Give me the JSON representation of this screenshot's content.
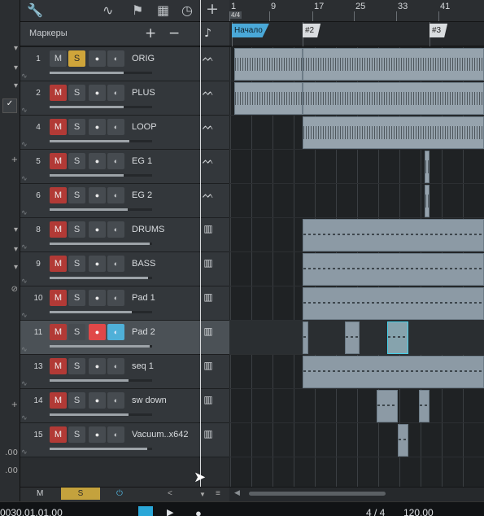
{
  "left_strip": {
    "items": [
      {
        "text": "▾",
        "kind": "arrow"
      },
      {
        "text": "▾",
        "kind": "arrow"
      },
      {
        "text": "▾",
        "kind": "arrow"
      },
      {
        "text": "✓",
        "kind": "box"
      },
      {
        "text": "+",
        "kind": "plain"
      },
      {
        "text": "▾",
        "kind": "arrow"
      },
      {
        "text": "▾",
        "kind": "arrow"
      },
      {
        "text": "▾",
        "kind": "arrow"
      },
      {
        "text": "⊘",
        "kind": "plain"
      },
      {
        "text": "+",
        "kind": "plain"
      },
      {
        "text": ".00",
        "kind": "plain"
      },
      {
        "text": ".00",
        "kind": "plain"
      }
    ]
  },
  "toolbar": {
    "icons": [
      "wrench-icon",
      "automation-icon",
      "marker-flag-icon",
      "grid-icon",
      "clock-icon",
      "add-icon"
    ]
  },
  "markers_header": {
    "label": "Маркеры",
    "add": "+",
    "remove": "−",
    "note": "♪"
  },
  "tracks": [
    {
      "num": "1",
      "name": "ORIG",
      "mute_label": "M",
      "solo_label": "S",
      "muted": false,
      "soloed": true,
      "rec": false,
      "monitor": false,
      "type_icon": "audio-waveform-icon",
      "icon": "ᨓ",
      "fader": 0.72,
      "selected": false
    },
    {
      "num": "2",
      "name": "PLUS",
      "mute_label": "M",
      "solo_label": "S",
      "muted": true,
      "soloed": false,
      "rec": false,
      "monitor": false,
      "type_icon": "audio-waveform-icon",
      "icon": "ᨓ",
      "fader": 0.72,
      "selected": false
    },
    {
      "num": "4",
      "name": "LOOP",
      "mute_label": "M",
      "solo_label": "S",
      "muted": true,
      "soloed": false,
      "rec": false,
      "monitor": false,
      "type_icon": "audio-waveform-icon",
      "icon": "ᨓ",
      "fader": 0.78,
      "selected": false
    },
    {
      "num": "5",
      "name": "EG 1",
      "mute_label": "M",
      "solo_label": "S",
      "muted": true,
      "soloed": false,
      "rec": false,
      "monitor": false,
      "type_icon": "audio-waveform-icon",
      "icon": "ᨓ",
      "fader": 0.72,
      "selected": false
    },
    {
      "num": "6",
      "name": "EG 2",
      "mute_label": "M",
      "solo_label": "S",
      "muted": true,
      "soloed": false,
      "rec": false,
      "monitor": false,
      "type_icon": "audio-waveform-icon",
      "icon": "ᨓ",
      "fader": 0.76,
      "selected": false
    },
    {
      "num": "8",
      "name": "DRUMS",
      "mute_label": "M",
      "solo_label": "S",
      "muted": true,
      "soloed": false,
      "rec": false,
      "monitor": false,
      "type_icon": "instrument-keys-icon",
      "icon": "▥",
      "fader": 0.98,
      "selected": false
    },
    {
      "num": "9",
      "name": "BASS",
      "mute_label": "M",
      "solo_label": "S",
      "muted": true,
      "soloed": false,
      "rec": false,
      "monitor": false,
      "type_icon": "instrument-keys-icon",
      "icon": "▥",
      "fader": 0.96,
      "selected": false
    },
    {
      "num": "10",
      "name": "Pad 1",
      "mute_label": "M",
      "solo_label": "S",
      "muted": true,
      "soloed": false,
      "rec": false,
      "monitor": false,
      "type_icon": "instrument-keys-icon",
      "icon": "▥",
      "fader": 0.8,
      "selected": false
    },
    {
      "num": "11",
      "name": "Pad 2",
      "mute_label": "M",
      "solo_label": "S",
      "muted": true,
      "soloed": false,
      "rec": true,
      "monitor": true,
      "type_icon": "instrument-keys-icon",
      "icon": "▥",
      "fader": 0.98,
      "selected": true
    },
    {
      "num": "13",
      "name": "seq 1",
      "mute_label": "M",
      "solo_label": "S",
      "muted": true,
      "soloed": false,
      "rec": false,
      "monitor": false,
      "type_icon": "instrument-keys-icon",
      "icon": "▥",
      "fader": 0.77,
      "selected": false
    },
    {
      "num": "14",
      "name": "sw down",
      "mute_label": "M",
      "solo_label": "S",
      "muted": true,
      "soloed": false,
      "rec": false,
      "monitor": false,
      "type_icon": "instrument-keys-icon",
      "icon": "▥",
      "fader": 0.77,
      "selected": false
    },
    {
      "num": "15",
      "name": "Vacuum..x642",
      "mute_label": "M",
      "solo_label": "S",
      "muted": true,
      "soloed": false,
      "rec": false,
      "monitor": false,
      "type_icon": "instrument-keys-icon",
      "icon": "▥",
      "fader": 0.95,
      "selected": false
    }
  ],
  "list_footer": {
    "mute_all": "M",
    "solo_all": "S",
    "power": "⏻",
    "left": "<",
    "down": "▼",
    "menu": "≡"
  },
  "ruler": {
    "time_signature": "4/4",
    "bars": [
      "1",
      "9",
      "17",
      "25",
      "33",
      "41"
    ]
  },
  "markers": [
    {
      "label": "Начало",
      "color": "#4aa8d8",
      "text_color": "#10222c"
    },
    {
      "label": "#2",
      "color": "#d9dcdf",
      "text_color": "#222"
    },
    {
      "label": "#3",
      "color": "#d9dcdf",
      "text_color": "#222"
    }
  ],
  "transport": {
    "time": "0030.01.01.00",
    "signature": "4 / 4",
    "tempo": "120.00"
  },
  "colors": {
    "mute_active": "#b23a36",
    "solo_active": "#cfa53a",
    "record_active": "#e04848",
    "monitor_active": "#4fb0d8",
    "clip": "#8c9aa5",
    "selected_clip_border": "#46d0e8"
  }
}
